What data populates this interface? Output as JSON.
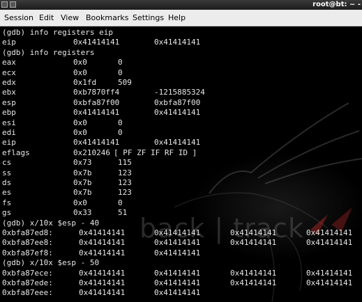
{
  "window": {
    "title": "root@bt: ~ -"
  },
  "menu": {
    "items": [
      "Session",
      "Edit",
      "View",
      "Bookmarks",
      "Settings",
      "Help"
    ]
  },
  "watermark": {
    "text": "back | track"
  },
  "terminal": {
    "lines": [
      {
        "kind": "cmd",
        "text": "(gdb) info registers eip"
      },
      {
        "kind": "reg",
        "name": "eip",
        "hex": "0x41414141",
        "val": "0x41414141"
      },
      {
        "kind": "cmd",
        "text": "(gdb) info registers"
      },
      {
        "kind": "reg",
        "name": "eax",
        "hex": "0x0",
        "val": "0"
      },
      {
        "kind": "reg",
        "name": "ecx",
        "hex": "0x0",
        "val": "0"
      },
      {
        "kind": "reg",
        "name": "edx",
        "hex": "0x1fd",
        "val": "509"
      },
      {
        "kind": "reg",
        "name": "ebx",
        "hex": "0xb7870ff4",
        "val": "-1215885324"
      },
      {
        "kind": "reg",
        "name": "esp",
        "hex": "0xbfa87f00",
        "val": "0xbfa87f00"
      },
      {
        "kind": "reg",
        "name": "ebp",
        "hex": "0x41414141",
        "val": "0x41414141"
      },
      {
        "kind": "reg",
        "name": "esi",
        "hex": "0x0",
        "val": "0"
      },
      {
        "kind": "reg",
        "name": "edi",
        "hex": "0x0",
        "val": "0"
      },
      {
        "kind": "reg",
        "name": "eip",
        "hex": "0x41414141",
        "val": "0x41414141"
      },
      {
        "kind": "reg",
        "name": "eflags",
        "hex": "0x210246",
        "val": "[ PF ZF IF RF ID ]"
      },
      {
        "kind": "reg",
        "name": "cs",
        "hex": "0x73",
        "val": "115"
      },
      {
        "kind": "reg",
        "name": "ss",
        "hex": "0x7b",
        "val": "123"
      },
      {
        "kind": "reg",
        "name": "ds",
        "hex": "0x7b",
        "val": "123"
      },
      {
        "kind": "reg",
        "name": "es",
        "hex": "0x7b",
        "val": "123"
      },
      {
        "kind": "reg",
        "name": "fs",
        "hex": "0x0",
        "val": "0"
      },
      {
        "kind": "reg",
        "name": "gs",
        "hex": "0x33",
        "val": "51"
      },
      {
        "kind": "cmd",
        "text": "(gdb) x/10x $esp - 40"
      },
      {
        "kind": "mem",
        "addr": "0xbfa87ed8:",
        "words": [
          "0x41414141",
          "0x41414141",
          "0x41414141",
          "0x41414141"
        ]
      },
      {
        "kind": "mem",
        "addr": "0xbfa87ee8:",
        "words": [
          "0x41414141",
          "0x41414141",
          "0x41414141",
          "0x41414141"
        ]
      },
      {
        "kind": "mem",
        "addr": "0xbfa87ef8:",
        "words": [
          "0x41414141",
          "0x41414141"
        ]
      },
      {
        "kind": "cmd",
        "text": "(gdb) x/10x $esp - 50"
      },
      {
        "kind": "mem",
        "addr": "0xbfa87ece:",
        "words": [
          "0x41414141",
          "0x41414141",
          "0x41414141",
          "0x41414141"
        ]
      },
      {
        "kind": "mem",
        "addr": "0xbfa87ede:",
        "words": [
          "0x41414141",
          "0x41414141",
          "0x41414141",
          "0x41414141"
        ]
      },
      {
        "kind": "mem",
        "addr": "0xbfa87eee:",
        "words": [
          "0x41414141",
          "0x41414141"
        ]
      }
    ]
  }
}
